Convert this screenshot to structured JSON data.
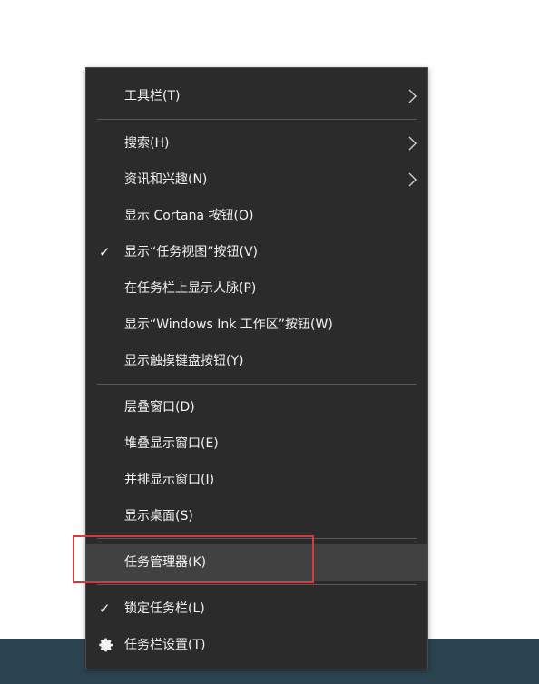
{
  "menu": {
    "items": [
      {
        "label": "工具栏(T)",
        "checked": false,
        "submenu": true
      },
      {
        "label": "搜索(H)",
        "checked": false,
        "submenu": true
      },
      {
        "label": "资讯和兴趣(N)",
        "checked": false,
        "submenu": true
      },
      {
        "label": "显示 Cortana 按钮(O)",
        "checked": false,
        "submenu": false
      },
      {
        "label": "显示“任务视图”按钮(V)",
        "checked": true,
        "submenu": false
      },
      {
        "label": "在任务栏上显示人脉(P)",
        "checked": false,
        "submenu": false
      },
      {
        "label": "显示“Windows Ink 工作区”按钮(W)",
        "checked": false,
        "submenu": false
      },
      {
        "label": "显示触摸键盘按钮(Y)",
        "checked": false,
        "submenu": false
      },
      {
        "label": "层叠窗口(D)",
        "checked": false,
        "submenu": false
      },
      {
        "label": "堆叠显示窗口(E)",
        "checked": false,
        "submenu": false
      },
      {
        "label": "并排显示窗口(I)",
        "checked": false,
        "submenu": false
      },
      {
        "label": "显示桌面(S)",
        "checked": false,
        "submenu": false
      },
      {
        "label": "任务管理器(K)",
        "checked": false,
        "submenu": false,
        "highlighted": true
      },
      {
        "label": "锁定任务栏(L)",
        "checked": true,
        "submenu": false
      },
      {
        "label": "任务栏设置(T)",
        "checked": false,
        "submenu": false,
        "icon": "gear-icon"
      }
    ],
    "check_glyph": "✓"
  },
  "colors": {
    "menu_bg": "#2b2b2b",
    "hover_bg": "#414141",
    "text": "#f2f2f2",
    "separator": "#5a5a5a",
    "annotation": "#d23c3c",
    "taskbar": "#2c4450"
  }
}
